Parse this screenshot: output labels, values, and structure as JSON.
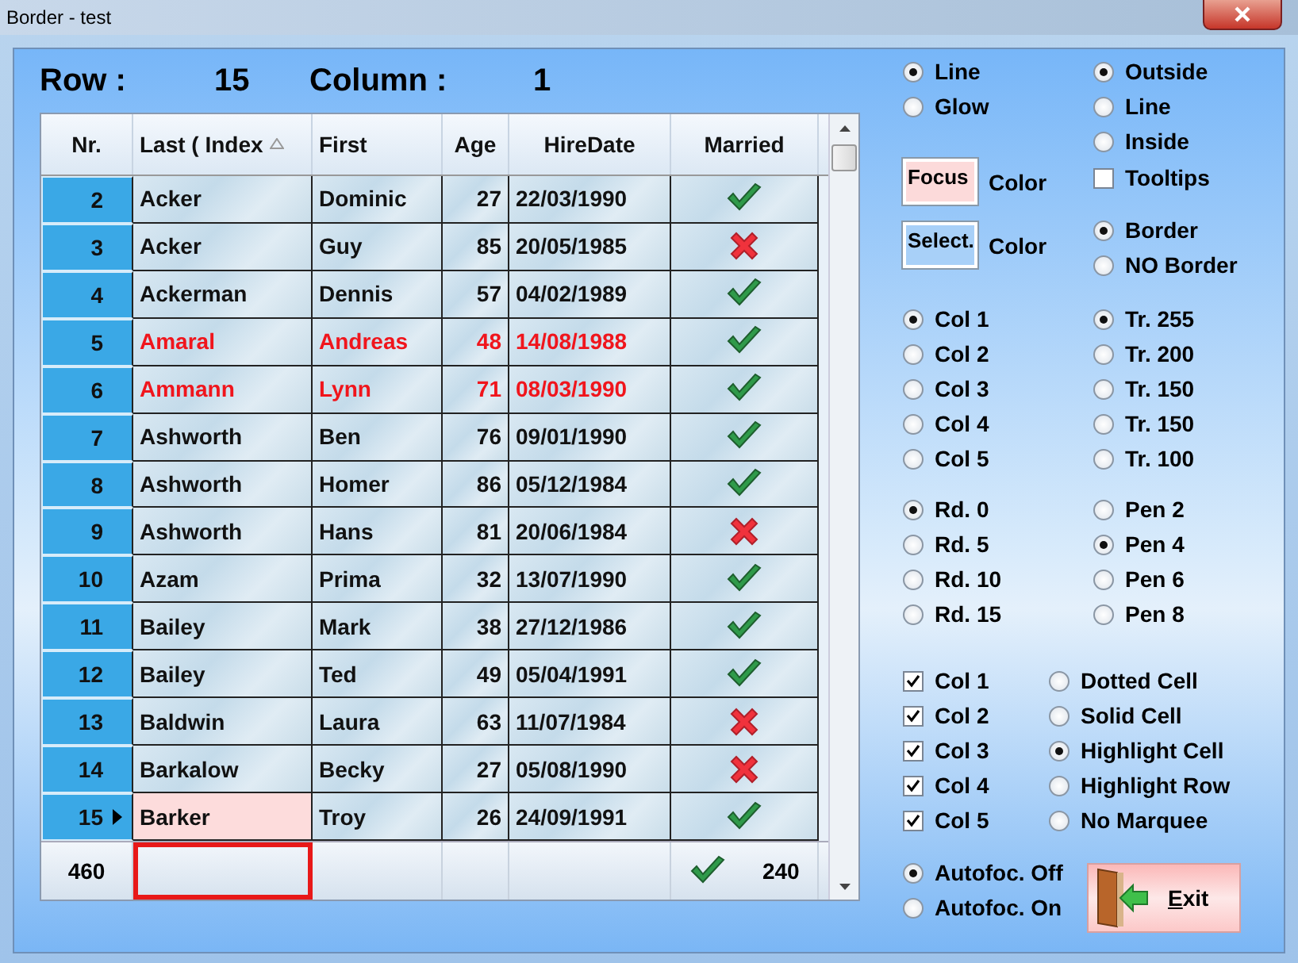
{
  "window": {
    "title": "Border - test"
  },
  "position": {
    "row_label": "Row :",
    "row": "15",
    "column_label": "Column :",
    "column": "1"
  },
  "grid": {
    "columns": [
      {
        "label": "Nr.",
        "sorted": false
      },
      {
        "label": "Last ( Index",
        "sorted": true
      },
      {
        "label": "First",
        "sorted": false
      },
      {
        "label": "Age",
        "sorted": false
      },
      {
        "label": "HireDate",
        "sorted": false
      },
      {
        "label": "Married",
        "sorted": false
      }
    ],
    "rows": [
      {
        "nr": "2",
        "last": "Acker",
        "first": "Dominic",
        "age": "27",
        "hired": "22/03/1990",
        "married": true,
        "highlighted": false,
        "current": false
      },
      {
        "nr": "3",
        "last": "Acker",
        "first": "Guy",
        "age": "85",
        "hired": "20/05/1985",
        "married": false,
        "highlighted": false,
        "current": false
      },
      {
        "nr": "4",
        "last": "Ackerman",
        "first": "Dennis",
        "age": "57",
        "hired": "04/02/1989",
        "married": true,
        "highlighted": false,
        "current": false
      },
      {
        "nr": "5",
        "last": "Amaral",
        "first": "Andreas",
        "age": "48",
        "hired": "14/08/1988",
        "married": true,
        "highlighted": true,
        "current": false
      },
      {
        "nr": "6",
        "last": "Ammann",
        "first": "Lynn",
        "age": "71",
        "hired": "08/03/1990",
        "married": true,
        "highlighted": true,
        "current": false
      },
      {
        "nr": "7",
        "last": "Ashworth",
        "first": "Ben",
        "age": "76",
        "hired": "09/01/1990",
        "married": true,
        "highlighted": false,
        "current": false
      },
      {
        "nr": "8",
        "last": "Ashworth",
        "first": "Homer",
        "age": "86",
        "hired": "05/12/1984",
        "married": true,
        "highlighted": false,
        "current": false
      },
      {
        "nr": "9",
        "last": "Ashworth",
        "first": "Hans",
        "age": "81",
        "hired": "20/06/1984",
        "married": false,
        "highlighted": false,
        "current": false
      },
      {
        "nr": "10",
        "last": "Azam",
        "first": "Prima",
        "age": "32",
        "hired": "13/07/1990",
        "married": true,
        "highlighted": false,
        "current": false
      },
      {
        "nr": "11",
        "last": "Bailey",
        "first": "Mark",
        "age": "38",
        "hired": "27/12/1986",
        "married": true,
        "highlighted": false,
        "current": false
      },
      {
        "nr": "12",
        "last": "Bailey",
        "first": "Ted",
        "age": "49",
        "hired": "05/04/1991",
        "married": true,
        "highlighted": false,
        "current": false
      },
      {
        "nr": "13",
        "last": "Baldwin",
        "first": "Laura",
        "age": "63",
        "hired": "11/07/1984",
        "married": false,
        "highlighted": false,
        "current": false
      },
      {
        "nr": "14",
        "last": "Barkalow",
        "first": "Becky",
        "age": "27",
        "hired": "05/08/1990",
        "married": false,
        "highlighted": false,
        "current": false
      },
      {
        "nr": "15",
        "last": "Barker",
        "first": "Troy",
        "age": "26",
        "hired": "24/09/1991",
        "married": true,
        "highlighted": false,
        "current": true
      }
    ],
    "footer": {
      "count": "460",
      "last_focused": true,
      "married_total": "240"
    }
  },
  "options": {
    "style": [
      {
        "label": "Line",
        "selected": true
      },
      {
        "label": "Glow",
        "selected": false
      }
    ],
    "placement": [
      {
        "label": "Outside",
        "selected": true
      },
      {
        "label": "Line",
        "selected": false
      },
      {
        "label": "Inside",
        "selected": false
      }
    ],
    "focus_color": {
      "label": "Focus",
      "caption": "Color"
    },
    "tooltips": {
      "label": "Tooltips",
      "checked": false
    },
    "select_color": {
      "label": "Select.",
      "caption": "Color"
    },
    "border": [
      {
        "label": "Border",
        "selected": true
      },
      {
        "label": "NO Border",
        "selected": false
      }
    ],
    "colors": [
      {
        "label": "Col 1",
        "selected": true
      },
      {
        "label": "Col 2",
        "selected": false
      },
      {
        "label": "Col 3",
        "selected": false
      },
      {
        "label": "Col 4",
        "selected": false
      },
      {
        "label": "Col 5",
        "selected": false
      }
    ],
    "transparency": [
      {
        "label": "Tr. 255",
        "selected": true
      },
      {
        "label": "Tr. 200",
        "selected": false
      },
      {
        "label": "Tr. 150",
        "selected": false
      },
      {
        "label": "Tr. 150",
        "selected": false
      },
      {
        "label": "Tr. 100",
        "selected": false
      }
    ],
    "radius": [
      {
        "label": "Rd. 0",
        "selected": true
      },
      {
        "label": "Rd. 5",
        "selected": false
      },
      {
        "label": "Rd. 10",
        "selected": false
      },
      {
        "label": "Rd. 15",
        "selected": false
      }
    ],
    "pen": [
      {
        "label": "Pen 2",
        "selected": false
      },
      {
        "label": "Pen 4",
        "selected": true
      },
      {
        "label": "Pen 6",
        "selected": false
      },
      {
        "label": "Pen 8",
        "selected": false
      }
    ],
    "visible_columns": [
      {
        "label": "Col 1",
        "checked": true
      },
      {
        "label": "Col 2",
        "checked": true
      },
      {
        "label": "Col 3",
        "checked": true
      },
      {
        "label": "Col 4",
        "checked": true
      },
      {
        "label": "Col 5",
        "checked": true
      }
    ],
    "marquee": [
      {
        "label": "Dotted Cell",
        "selected": false
      },
      {
        "label": "Solid Cell",
        "selected": false
      },
      {
        "label": "Highlight Cell",
        "selected": true
      },
      {
        "label": "Highlight Row",
        "selected": false
      },
      {
        "label": "No Marquee",
        "selected": false
      }
    ],
    "autofocus": [
      {
        "label": "Autofoc. Off",
        "selected": true
      },
      {
        "label": "Autofoc. On",
        "selected": false
      }
    ],
    "exit_button": {
      "label": "Exit"
    }
  }
}
